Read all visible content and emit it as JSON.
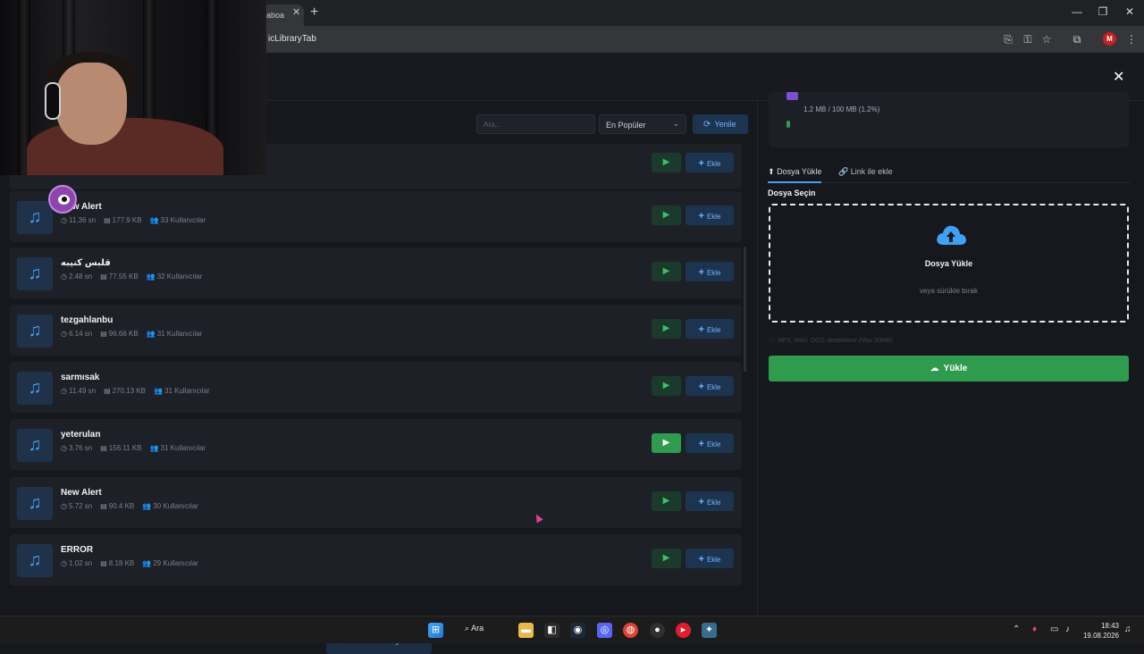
{
  "browser": {
    "tab_title": "aboa",
    "url": "icLibraryTab",
    "profile_initial": "M"
  },
  "toolbar": {
    "search_placeholder": "Ara...",
    "sort_value": "En Popüler",
    "refresh_label": "Yenile"
  },
  "sounds": [
    {
      "title": "",
      "duration": "",
      "size": "",
      "users": "",
      "play_active": false
    },
    {
      "title": "New Alert",
      "duration": "11.36 sn",
      "size": "177.9 KB",
      "users": "33 Kullanıcılar",
      "play_active": false
    },
    {
      "title": "قلبس كنيبه",
      "duration": "2.48 sn",
      "size": "77.55 KB",
      "users": "32 Kullanıcılar",
      "play_active": false
    },
    {
      "title": "tezgahlanbu",
      "duration": "6.14 sn",
      "size": "96.66 KB",
      "users": "31 Kullanıcılar",
      "play_active": false
    },
    {
      "title": "sarmısak",
      "duration": "11.49 sn",
      "size": "270.13 KB",
      "users": "31 Kullanıcılar",
      "play_active": false
    },
    {
      "title": "yeterulan",
      "duration": "3.76 sn",
      "size": "156.11 KB",
      "users": "31 Kullanıcılar",
      "play_active": true
    },
    {
      "title": "New Alert",
      "duration": "5.72 sn",
      "size": "90.4 KB",
      "users": "30 Kullanıcılar",
      "play_active": false
    },
    {
      "title": "ERROR",
      "duration": "1.02 sn",
      "size": "8.18 KB",
      "users": "29 Kullanıcılar",
      "play_active": false
    }
  ],
  "add_label": "Ekle",
  "load_more_label": "Daha fazla yükle",
  "storage": {
    "text": "1.2 MB / 100 MB (1.2%)",
    "used_percent": 1.2
  },
  "upload_tabs": {
    "file_upload": "Dosya Yükle",
    "link_add": "Link ile ekle"
  },
  "upload": {
    "section_label": "Dosya Seçin",
    "dropzone_title": "Dosya Yükle",
    "dropzone_sub": "veya sürükle bırak",
    "hint": "MP3, WAV, OGG desteklenir (Max 50MB)",
    "button_label": "Yükle"
  },
  "taskbar": {
    "search_label": "Ara",
    "time": "18:43",
    "date": "19.08.2026"
  },
  "colors": {
    "accent_blue": "#3fa0f5",
    "accent_green": "#2f9b4f",
    "background": "#16181e"
  }
}
